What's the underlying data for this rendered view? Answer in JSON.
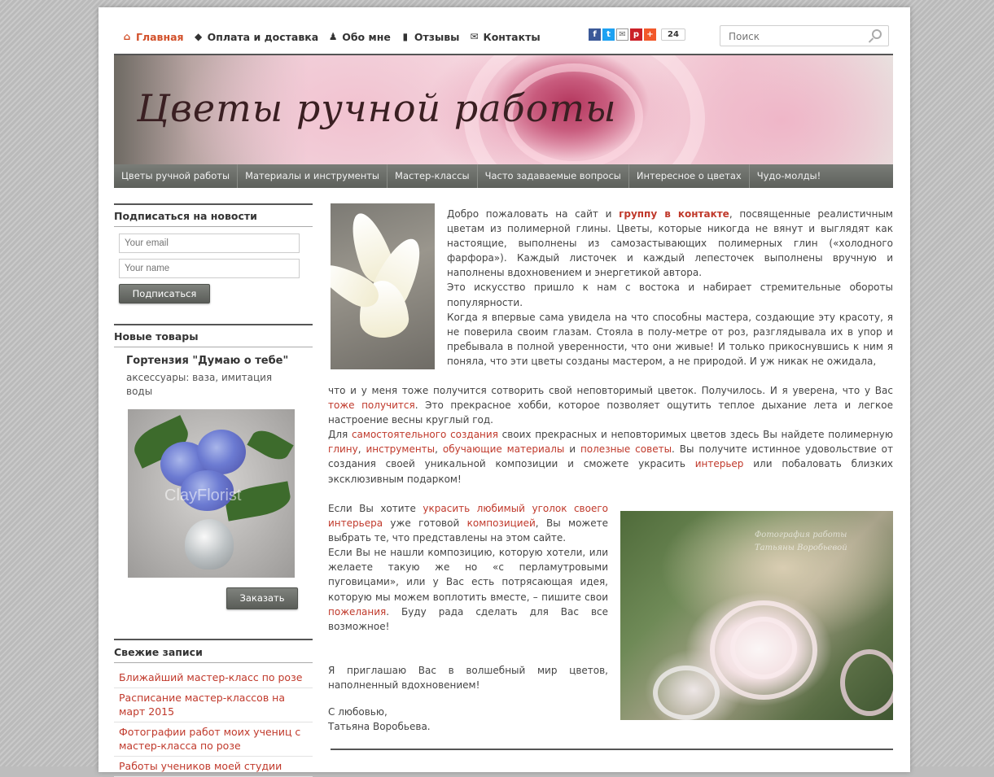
{
  "nav": {
    "items": [
      {
        "label": "Главная",
        "icon": "home-icon",
        "glyph": "⌂"
      },
      {
        "label": "Оплата и доставка",
        "icon": "tag-icon",
        "glyph": "◆"
      },
      {
        "label": "Обо мне",
        "icon": "user-icon",
        "glyph": "♟"
      },
      {
        "label": "Отзывы",
        "icon": "comment-icon",
        "glyph": "▮"
      },
      {
        "label": "Контакты",
        "icon": "mail-icon",
        "glyph": "✉"
      }
    ],
    "share_count": "24"
  },
  "search": {
    "placeholder": "Поиск"
  },
  "banner": {
    "title": "Цветы ручной работы"
  },
  "menu": {
    "items": [
      "Цветы ручной работы",
      "Материалы и инструменты",
      "Мастер-классы",
      "Часто задаваемые вопросы",
      "Интересное о цветах",
      "Чудо-молды!"
    ]
  },
  "subscribe": {
    "title": "Подписаться на новости",
    "email_placeholder": "Your email",
    "name_placeholder": "Your name",
    "button": "Подписаться"
  },
  "new_products": {
    "title": "Новые товары",
    "product_name": "Гортензия \"Думаю о тебе\"",
    "product_desc": "аксессуары: ваза, имитация воды",
    "watermark": "ClayFlorist",
    "order_button": "Заказать"
  },
  "recent": {
    "title": "Свежие записи",
    "items": [
      "Ближайший мастер-класс по розе",
      "Расписание мастер-классов на март 2015",
      "Фотографии работ моих учениц с мастер-класса по розе",
      "Работы учеников моей студии"
    ]
  },
  "main": {
    "p1_a": "Добро пожаловать на сайт и ",
    "p1_link": "группу в контакте",
    "p1_b": ", посвященные реалистичным цветам из полимерной глины. Цветы, которые никогда не вянут и выглядят как настоящие, выполнены из самозастывающих полимерных глин («холодного фарфора»). Каждый листочек и каждый лепесточек выполнены вручную и наполнены вдохновением и энергетикой автора.",
    "p2": "Это искусство пришло к нам с востока и набирает стремительные обороты популярности.",
    "p3_a": "Когда я впервые сама увидела на что способны мастера, создающие эту красоту, я не поверила своим глазам. Стояла в полу-метре от роз, разглядывала их в упор и пребывала в полной уверенности, что они живые! И только прикоснувшись к ним я поняла, что эти цветы созданы мастером, а не природой. И уж никак не ожидала,",
    "p3_b": "что и у меня тоже получится сотворить свой неповторимый цветок. Получилось. И я уверена, что у Вас ",
    "p3_link": "тоже получится",
    "p3_c": ". Это прекрасное хобби, которое позволяет ощутить теплое дыхание лета и легкое настроение весны круглый год.",
    "p4_a": "Для ",
    "p4_link1": "самостоятельного создания",
    "p4_b": " своих прекрасных и неповторимых цветов здесь Вы найдете полимерную ",
    "p4_link2": "глину",
    "p4_c": ", ",
    "p4_link3": "инструменты",
    "p4_d": ", ",
    "p4_link4": "обучающие материалы",
    "p4_e": " и ",
    "p4_link5": "полезные советы",
    "p4_f": ". Вы получите истинное удовольствие от создания своей уникальной композиции и сможете украсить ",
    "p4_link6": "интерьер",
    "p4_g": " или побаловать близких эксклюзивным подарком!",
    "p5_a": "Если Вы хотите ",
    "p5_link1": "украсить любимый уголок своего интерьера",
    "p5_b": " уже готовой ",
    "p5_link2": "композицией",
    "p5_c": ", Вы можете выбрать те, что представлены на этом сайте.",
    "p6_a": "Если Вы не нашли композицию, которую хотели, или желаете такую же но «с перламутровыми пуговицами», или у Вас есть потрясающая идея, которую мы можем воплотить вместе, – пишите свои ",
    "p6_link": "пожелания",
    "p6_b": ". Буду рада сделать для Вас все возможное!",
    "p7": "Я приглашаю Вас в волшебный мир цветов, наполненный вдохновением!",
    "sig1": "С любовью,",
    "sig2": "Татьяна Воробьева.",
    "photo_watermark": "Фотография работы Татьяны Воробьевой"
  },
  "colors": {
    "accent": "#c0392b",
    "nav_active": "#d2502a",
    "menubar": "#666963"
  }
}
